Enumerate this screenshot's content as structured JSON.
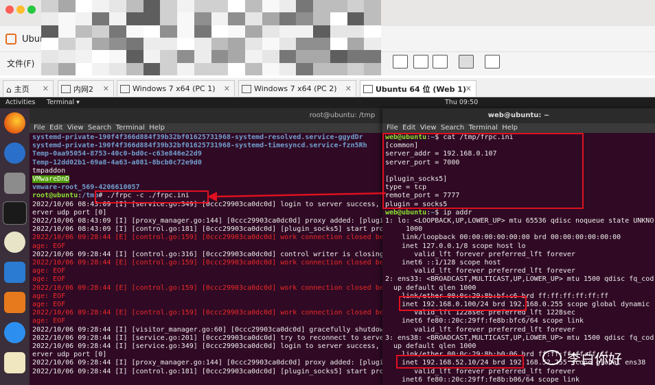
{
  "app_title": "Ubun",
  "menu": {
    "file": "文件(F)"
  },
  "tabs": [
    {
      "label": "主页"
    },
    {
      "label": "内网2"
    },
    {
      "label": "Windows 7 x64 (PC 1)"
    },
    {
      "label": "Windows 7 x64 (PC 2)"
    },
    {
      "label": "Ubuntu 64 位 (Web 1)"
    }
  ],
  "ubuntu_bar": {
    "activities": "Activities",
    "terminal": "Terminal ▾",
    "clock": "Thu 09:50"
  },
  "term1": {
    "title": "root@ubuntu: /tmp",
    "menu": "File  Edit  View  Search  Terminal  Help",
    "lines": [
      "systemd-private-190f4f366d884f39b32bf01625731968-systemd-resolved.service-ggydDr",
      "systemd-private-190f4f366d884f39b32bf01625731968-systemd-timesyncd.service-fzn5Rh",
      "Temp-0aa95054-8753-40c0-bd0c-c63e846e22d9",
      "Temp-12dd02b1-69a8-4a63-a081-8bcb0c72e9d0",
      "tmpaddon",
      "VMwareDnD",
      "vmware-root_569-4206610057",
      "root@ubuntu:/tmp# ./frpc -c ./frpc.ini",
      "2022/10/06 08:43:09 [I] [service.go:349] [0ccc29903ca0dc0d] login to server success,",
      "erver udp port [0]",
      "2022/10/06 08:43:09 [I] [proxy_manager.go:144] [0ccc29903ca0dc0d] proxy added: [plugi",
      "2022/10/06 08:43:09 [I] [control.go:181] [0ccc29903ca0dc0d] [plugin_socks5] start pro",
      "2022/10/06 09:28:44 [E] [control.go:159] [0ccc29903ca0dc0d] work connection closed be",
      "age: EOF",
      "2022/10/06 09:28:44 [I] [control.go:316] [0ccc29903ca0dc0d] control writer is closing",
      "2022/10/06 09:28:44 [E] [control.go:159] [0ccc29903ca0dc0d] work connection closed be",
      "age: EOF",
      "age: EOF",
      "2022/10/06 09:28:44 [E] [control.go:159] [0ccc29903ca0dc0d] work connection closed be",
      "age: EOF",
      "age: EOF",
      "2022/10/06 09:28:44 [E] [control.go:159] [0ccc29903ca0dc0d] work connection closed be",
      "age: EOF",
      "2022/10/06 09:28:44 [I] [visitor_manager.go:60] [0ccc29903ca0dc0d] gracefully shutdow",
      "2022/10/06 09:28:44 [I] [service.go:201] [0ccc29903ca0dc0d] try to reconnect to serve",
      "2022/10/06 09:28:44 [I] [service.go:349] [0ccc29903ca0dc0d] login to server success,",
      "erver udp port [0]",
      "2022/10/06 09:28:44 [I] [proxy_manager.go:144] [0ccc29903ca0dc0d] proxy added: [plugi",
      "2022/10/06 09:28:44 [I] [control.go:181] [0ccc29903ca0dc0d] [plugin_socks5] start pro"
    ]
  },
  "term2": {
    "title": "web@ubuntu: ~",
    "menu": "File  Edit  View  Search  Terminal  Help",
    "lines": [
      "web@ubuntu:~$ cat /tmp/frpc.ini",
      "[common]",
      "server_addr = 192.168.0.107",
      "server_port = 7000",
      "",
      "[plugin_socks5]",
      "type = tcp",
      "remote_port = 7777",
      "plugin = socks5",
      "web@ubuntu:~$ ip addr",
      "1: lo: <LOOPBACK,UP,LOWER_UP> mtu 65536 qdisc noqueue state UNKNO",
      "     1000",
      "    link/loopback 00:00:00:00:00:00 brd 00:00:00:00:00:00",
      "    inet 127.0.0.1/8 scope host lo",
      "       valid_lft forever preferred_lft forever",
      "    inet6 ::1/128 scope host",
      "       valid_lft forever preferred_lft forever",
      "2: ens33: <BROADCAST,MULTICAST,UP,LOWER_UP> mtu 1500 qdisc fq_cod",
      "  up default qlen 1000",
      "    link/ether 00:0c:29:8b:bf:c6 brd ff:ff:ff:ff:ff:ff",
      "    inet 192.168.0.100/24 brd 192.168.0.255 scope global dynamic",
      "       valid_lft 1228sec preferred_lft 1228sec",
      "    inet6 fe80::20c:29ff:fe8b:bfc6/64 scope link",
      "       valid_lft forever preferred_lft forever",
      "3: ens38: <BROADCAST,MULTICAST,UP,LOWER_UP> mtu 1500 qdisc fq_cod",
      "  up default qlen 1000",
      "    link/ether 00:0c:29:8b:b0:06 brd ff:ff:ff:ff:ff:ff",
      "    inet 192.168.52.10/24 brd 192.168.52.255 scope global ens38",
      "       valid_lft forever preferred_lft forever",
      "    inet6 fe80::20c:29ff:fe8b:b06/64 scope link"
    ]
  },
  "watermark": "李白你好",
  "colors": {
    "terminal_bg": "#300a24",
    "highlight_box": "#e01020",
    "prompt_green": "#8ae234"
  }
}
